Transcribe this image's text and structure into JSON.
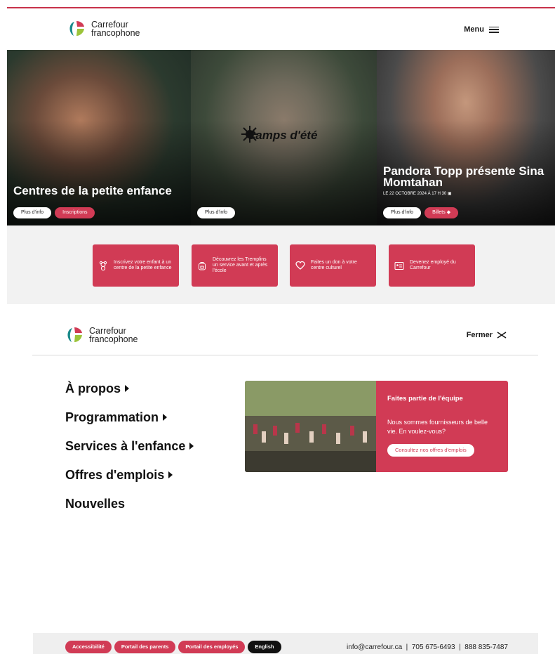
{
  "header": {
    "logo_line1": "Carrefour",
    "logo_line2": "francophone",
    "menu_label": "Menu"
  },
  "hero": [
    {
      "title": "Centres de la petite enfance",
      "buttons": [
        "Plus d'info",
        "Inscriptions"
      ]
    },
    {
      "title": "Camps d'été",
      "buttons": [
        "Plus d'info"
      ]
    },
    {
      "title": "Pandora Topp présente Sina Momtahan",
      "date": "LE 22 OCTOBRE 2024 À 17 H 30",
      "buttons": [
        "Plus d'info",
        "Billets"
      ]
    }
  ],
  "quick_links": [
    {
      "label": "Inscrivez votre enfant à un centre de la petite enfance",
      "icon": "teddy-bear-icon"
    },
    {
      "label": "Découvrez les Tremplins un service avant et après l'école",
      "icon": "backpack-icon"
    },
    {
      "label": "Faites un don à votre centre culturel",
      "icon": "heart-icon"
    },
    {
      "label": "Devenez employé du Carrefour",
      "icon": "id-card-icon"
    }
  ],
  "menu_panel": {
    "logo_line1": "Carrefour",
    "logo_line2": "francophone",
    "close_label": "Fermer",
    "nav": [
      {
        "label": "À propos",
        "arrow": true
      },
      {
        "label": "Programmation",
        "arrow": true
      },
      {
        "label": "Services à l'enfance",
        "arrow": true
      },
      {
        "label": "Offres d'emplois",
        "arrow": true
      },
      {
        "label": "Nouvelles",
        "arrow": false
      }
    ],
    "promo": {
      "title": "Faites partie de l'équipe",
      "text": "Nous sommes fournisseurs de belle vie. En voulez-vous?",
      "cta": "Consultez nos offres d'emplois"
    }
  },
  "footer": {
    "buttons": [
      "Accessibilité",
      "Portail des parents",
      "Portail des employés",
      "English"
    ],
    "contact": "info@carrefour.ca  |  705 675-6493  |  888 835-7487"
  },
  "colors": {
    "brand_red": "#d13b55",
    "brand_teal": "#1a8a8a",
    "brand_green": "#9cc43a"
  }
}
